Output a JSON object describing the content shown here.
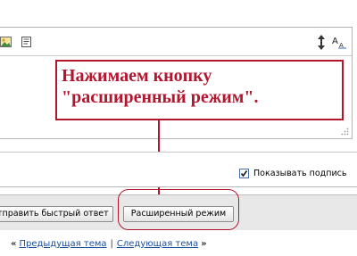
{
  "annotation": {
    "text_line1": "Нажимаем кнопку",
    "text_line2": "\"расширенный режим\".",
    "color": "#b2162e"
  },
  "options": {
    "show_signature_label": "Показывать подпись",
    "show_signature_checked": true
  },
  "buttons": {
    "quick_reply_label": "тправить быстрый ответ",
    "advanced_mode_label": "Расширенный режим"
  },
  "topic_nav": {
    "prev_arrow": "«",
    "prev_label": "Предыдущая тема",
    "separator": "|",
    "next_label": "Следующая тема",
    "next_arrow": "»"
  },
  "icons": {
    "toolbar": [
      "image-icon",
      "quote-icon",
      "resize-icon",
      "font-size-icon"
    ],
    "editor": [
      "resize-grip-icon"
    ]
  }
}
